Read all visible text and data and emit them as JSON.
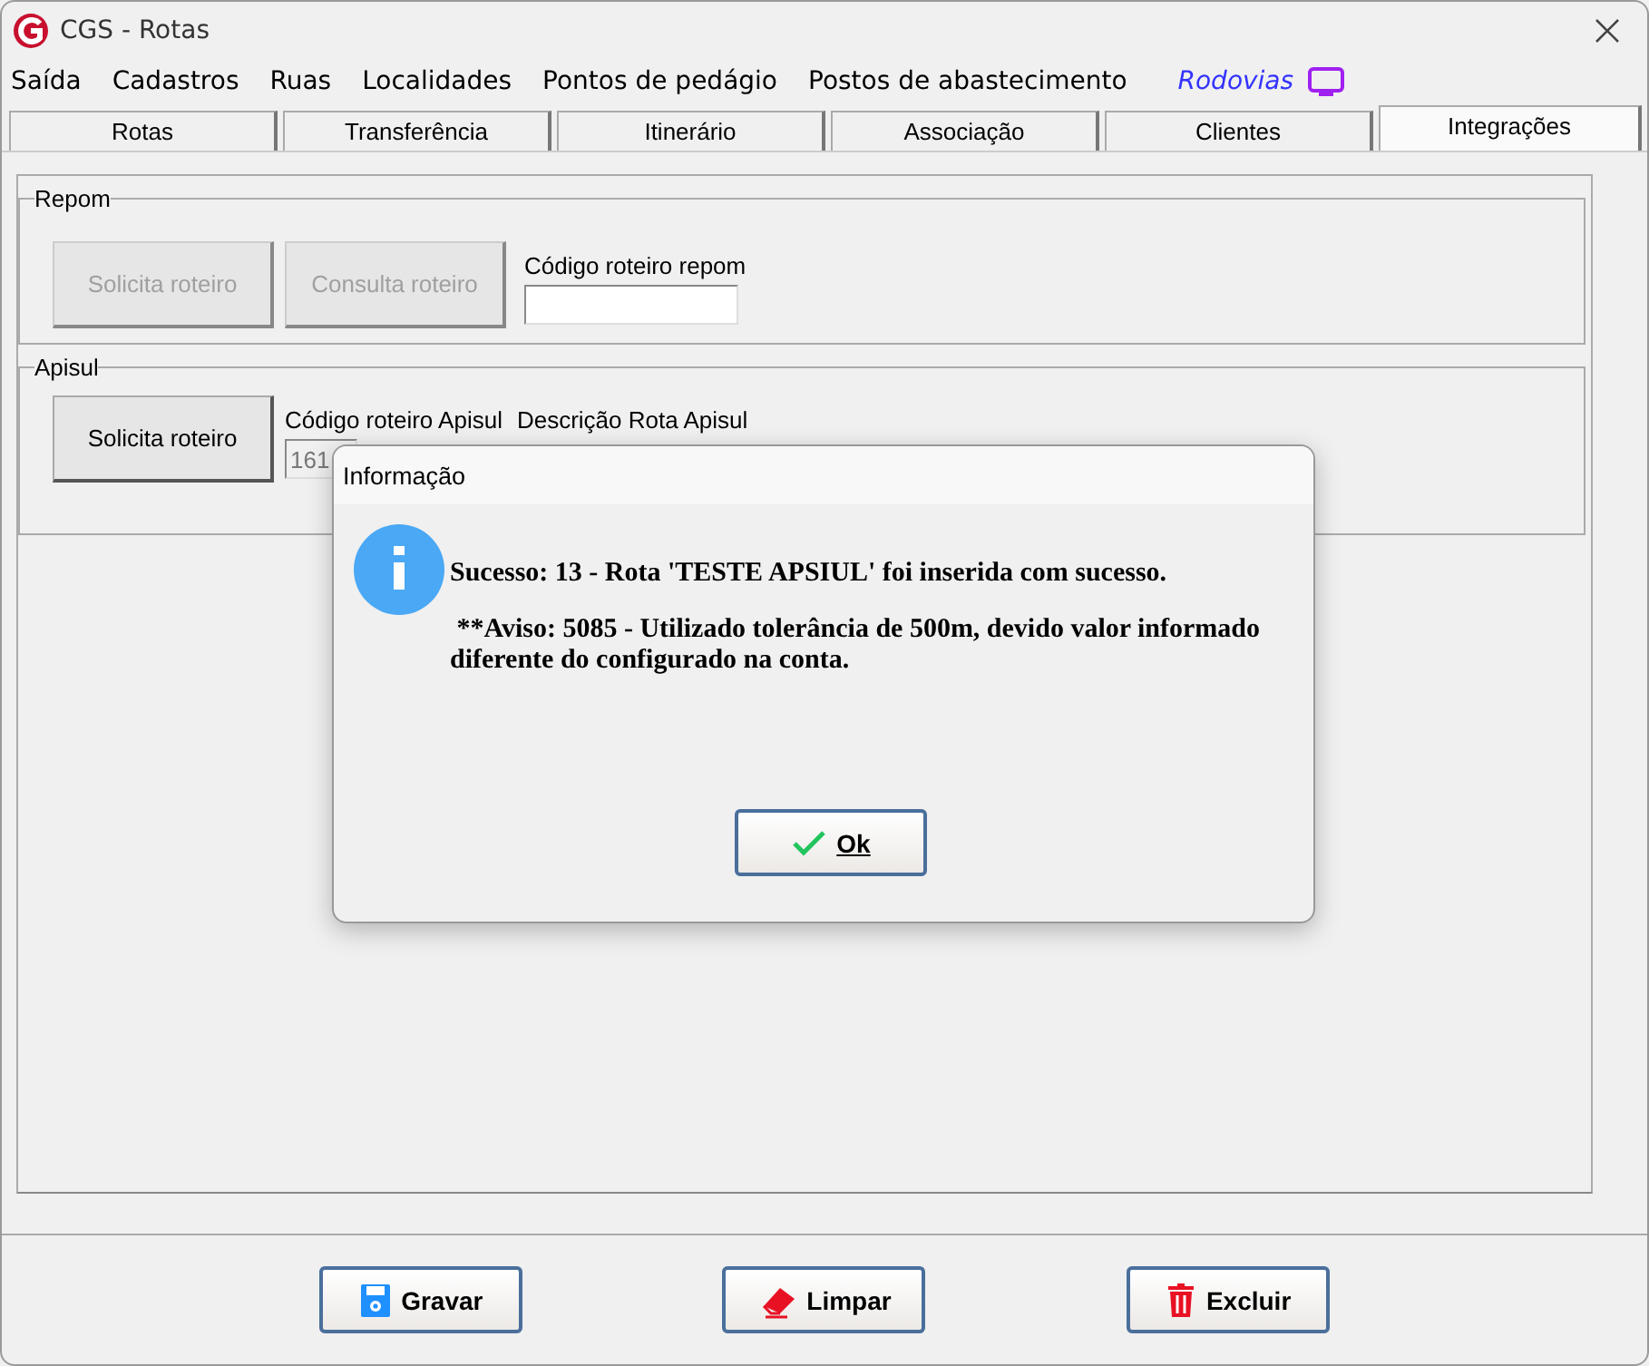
{
  "window": {
    "title": "CGS - Rotas"
  },
  "menu": [
    {
      "label": "Saída"
    },
    {
      "label": "Cadastros"
    },
    {
      "label": "Ruas"
    },
    {
      "label": "Localidades"
    },
    {
      "label": "Pontos de pedágio"
    },
    {
      "label": "Postos de abastecimento"
    },
    {
      "label": "Rodovias",
      "kind": "highlight"
    }
  ],
  "tabs": [
    {
      "label": "Rotas",
      "selected": false
    },
    {
      "label": "Transferência",
      "selected": false
    },
    {
      "label": "Itinerário",
      "selected": false
    },
    {
      "label": "Associação",
      "selected": false
    },
    {
      "label": "Clientes",
      "selected": false
    },
    {
      "label": "Integrações",
      "selected": true
    }
  ],
  "groups": [
    {
      "title": "Repom",
      "buttons": [
        {
          "label": "Solicita roteiro",
          "disabled": true
        },
        {
          "label": "Consulta roteiro",
          "disabled": true
        }
      ],
      "fields": [
        {
          "label": "Código roteiro repom"
        }
      ]
    },
    {
      "title": "Apisul",
      "buttons": [
        {
          "label": "Solicita roteiro",
          "disabled": false
        }
      ],
      "fields": [
        {
          "label": "Código roteiro Apisul",
          "value": "161"
        },
        {
          "label": "Descrição Rota Apisul"
        }
      ]
    }
  ],
  "dialog": {
    "title": "Informação",
    "message": "Sucesso: 13 - Rota 'TESTE APSIUL' foi inserida com sucesso.",
    "warning": " **Aviso: 5085 - Utilizado tolerância de 500m, devido valor informado diferente do configurado na conta.",
    "button": "Ok"
  },
  "footer_buttons": [
    {
      "label": "Gravar",
      "kind": "save"
    },
    {
      "label": "Limpar",
      "kind": "clear"
    },
    {
      "label": "Excluir",
      "kind": "delete"
    }
  ]
}
